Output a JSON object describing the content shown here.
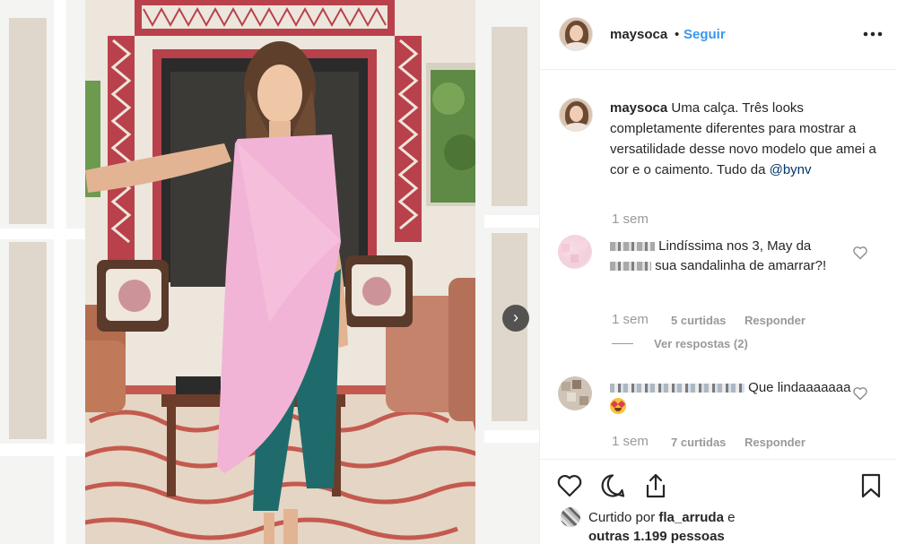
{
  "post": {
    "username": "maysoca",
    "separator": "•",
    "follow_label": "Seguir",
    "more_icon": "more-horizontal-icon",
    "next_icon": "chevron-right-icon"
  },
  "caption": {
    "username": "maysoca",
    "text": "Uma calça. Três looks completamente diferentes para mostrar a versatilidade desse novo modelo que amei a cor e o caimento. Tudo da ",
    "mention": "@bynv",
    "time": "1 sem"
  },
  "comments": [
    {
      "text_a": "Lindíssima nos 3, May da",
      "text_b": "sua sandalinha de amarrar?!",
      "time": "1 sem",
      "likes": "5 curtidas",
      "reply": "Responder",
      "view_replies": "Ver respostas (2)"
    },
    {
      "text_a": "Que lindaaaaaaa",
      "time": "1 sem",
      "likes": "7 curtidas",
      "reply": "Responder"
    }
  ],
  "actions": {
    "like_icon": "heart-icon",
    "comment_icon": "comment-icon",
    "share_icon": "share-icon",
    "save_icon": "bookmark-icon"
  },
  "likes": {
    "prefix": "Curtido por",
    "user": "fla_arruda",
    "conj": "e",
    "others": "outras 1.199 pessoas"
  }
}
